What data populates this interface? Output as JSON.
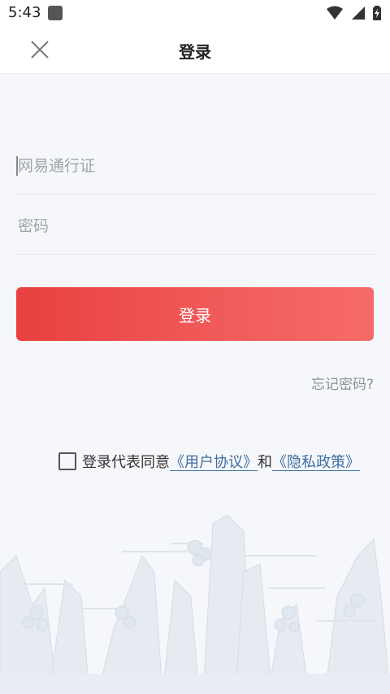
{
  "status_bar": {
    "time": "5:43",
    "icons": [
      "android-app-icon",
      "wifi-icon",
      "signal-icon",
      "battery-charging-icon"
    ]
  },
  "header": {
    "title": "登录",
    "close_icon": "close-icon"
  },
  "form": {
    "account_placeholder": "网易通行证",
    "account_value": "",
    "password_placeholder": "密码",
    "password_value": "",
    "login_label": "登录",
    "forgot_label": "忘记密码?"
  },
  "agreement": {
    "prefix": "登录代表同意",
    "user_agreement": "《用户协议》",
    "conjunction": "和",
    "privacy_policy": "《隐私政策》",
    "checked": false
  },
  "colors": {
    "accent": "#e8403e",
    "link": "#3f6f9e",
    "background": "#f5f7fa"
  }
}
